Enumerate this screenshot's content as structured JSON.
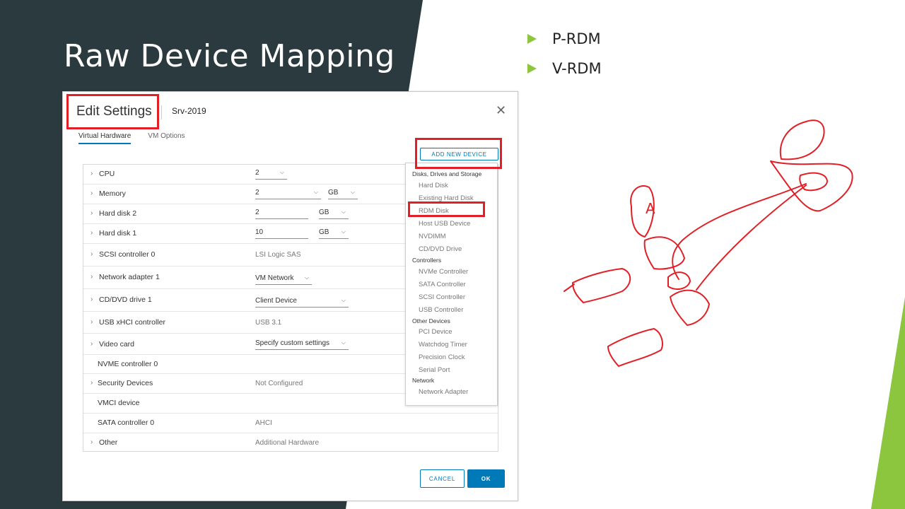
{
  "slide": {
    "title": "Raw Device Mapping",
    "bullets": [
      "P-RDM",
      "V-RDM"
    ],
    "colors": {
      "dark": "#2b3a3f",
      "accent": "#8cc63f",
      "annotation": "#e21f26"
    }
  },
  "dialog": {
    "title": "Edit Settings",
    "subtitle": "Srv-2019",
    "close_icon": "close-icon",
    "tabs": [
      "Virtual Hardware",
      "VM Options"
    ],
    "add_new_device": "ADD NEW DEVICE",
    "hardware": [
      {
        "label": "CPU",
        "value": "2"
      },
      {
        "label": "Memory",
        "value": "2",
        "unit": "GB"
      },
      {
        "label": "Hard disk 2",
        "value": "2",
        "unit": "GB"
      },
      {
        "label": "Hard disk 1",
        "value": "10",
        "unit": "GB"
      },
      {
        "label": "SCSI controller 0",
        "value": "LSI Logic SAS"
      },
      {
        "label": "Network adapter 1",
        "value": "VM Network"
      },
      {
        "label": "CD/DVD drive 1",
        "value": "Client Device"
      },
      {
        "label": "USB xHCI controller",
        "value": "USB 3.1"
      },
      {
        "label": "Video card",
        "value": "Specify custom settings"
      },
      {
        "label": "NVME controller 0",
        "value": ""
      },
      {
        "label": "Security Devices",
        "value": "Not Configured"
      },
      {
        "label": "VMCI device",
        "value": ""
      },
      {
        "label": "SATA controller 0",
        "value": "AHCI"
      },
      {
        "label": "Other",
        "value": "Additional Hardware"
      }
    ],
    "menu": {
      "groups": [
        {
          "heading": "Disks, Drives and Storage",
          "items": [
            "Hard Disk",
            "Existing Hard Disk",
            "RDM Disk",
            "Host USB Device",
            "NVDIMM",
            "CD/DVD Drive"
          ]
        },
        {
          "heading": "Controllers",
          "items": [
            "NVMe Controller",
            "SATA Controller",
            "SCSI Controller",
            "USB Controller"
          ]
        },
        {
          "heading": "Other Devices",
          "items": [
            "PCI Device",
            "Watchdog Timer",
            "Precision Clock",
            "Serial Port"
          ]
        },
        {
          "heading": "Network",
          "items": [
            "Network Adapter"
          ]
        }
      ]
    },
    "buttons": {
      "cancel": "CANCEL",
      "ok": "OK"
    }
  },
  "annotations": {
    "sketch_letter": "A"
  }
}
